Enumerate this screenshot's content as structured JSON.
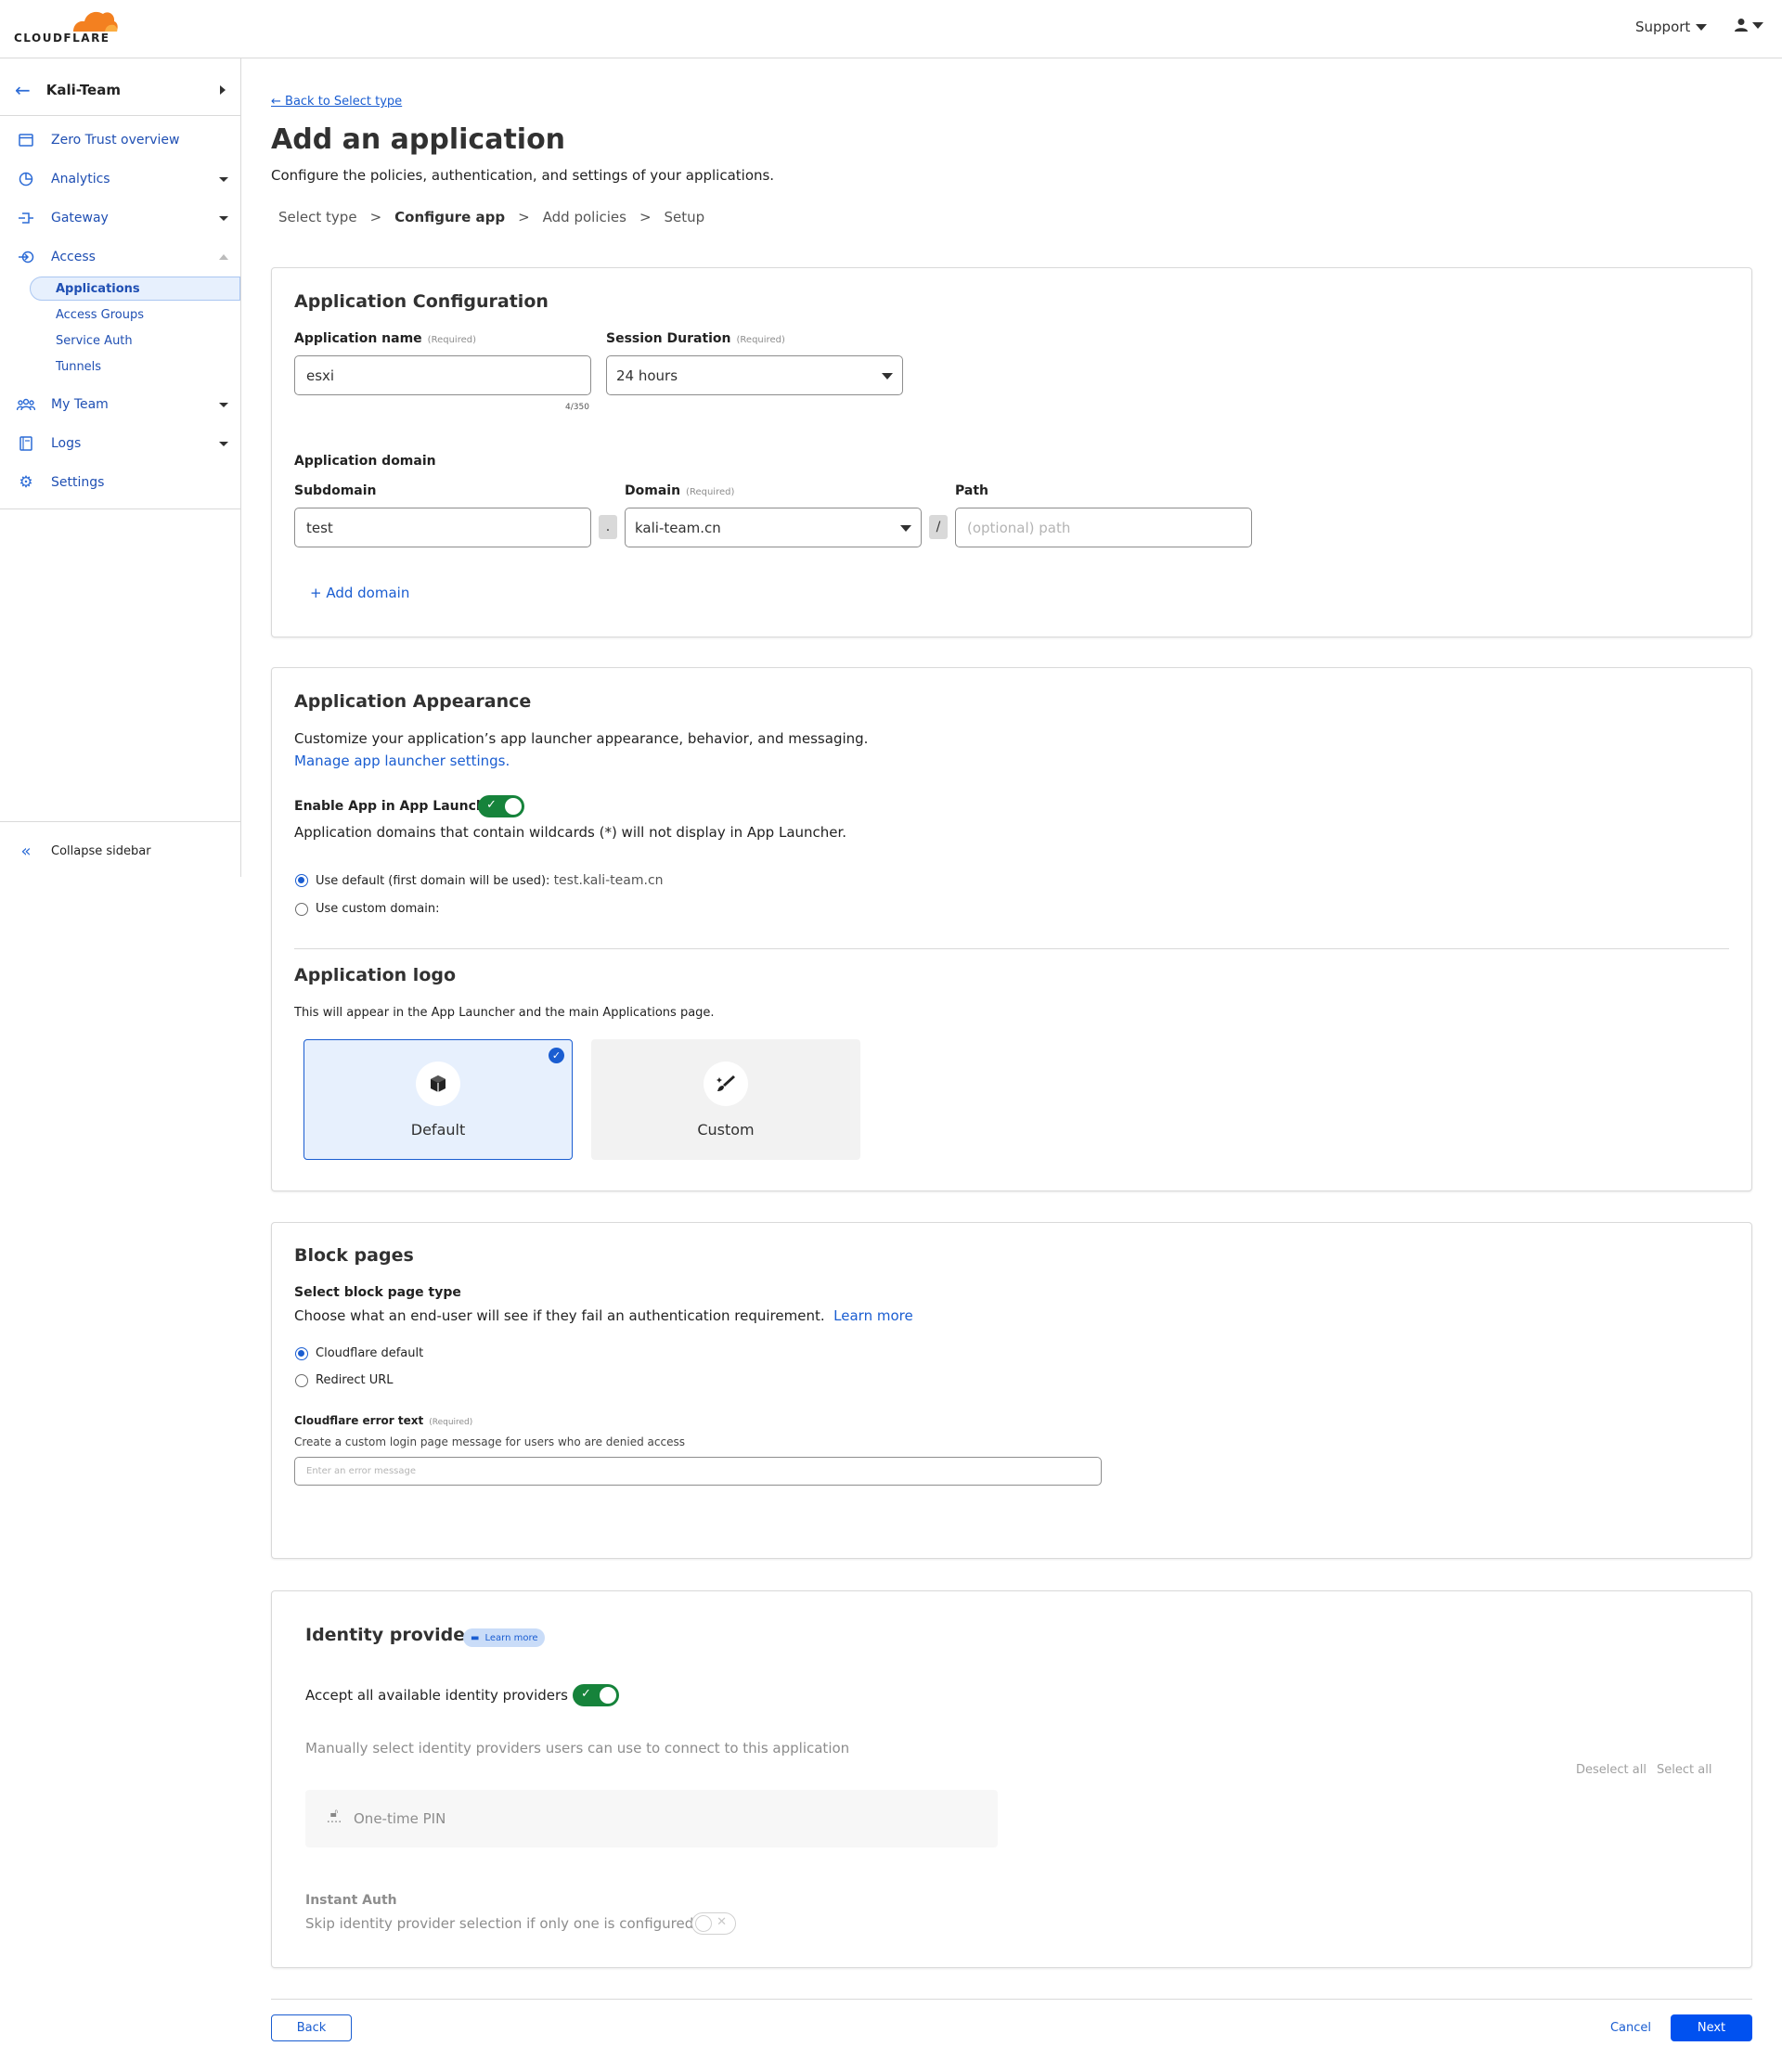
{
  "header": {
    "logo_text": "CLOUDFLARE",
    "support_label": "Support"
  },
  "sidebar": {
    "account_name": "Kali-Team",
    "items": [
      {
        "label": "Zero Trust overview",
        "icon": "window-icon"
      },
      {
        "label": "Analytics",
        "icon": "chart-icon"
      },
      {
        "label": "Gateway",
        "icon": "gateway-icon"
      },
      {
        "label": "Access",
        "icon": "access-icon"
      },
      {
        "label": "My Team",
        "icon": "team-icon"
      },
      {
        "label": "Logs",
        "icon": "logs-icon"
      },
      {
        "label": "Settings",
        "icon": "gear-icon"
      }
    ],
    "access_sub": [
      {
        "label": "Applications"
      },
      {
        "label": "Access Groups"
      },
      {
        "label": "Service Auth"
      },
      {
        "label": "Tunnels"
      }
    ],
    "collapse_label": "Collapse sidebar"
  },
  "page": {
    "back_link": "← Back to Select type",
    "title": "Add an application",
    "subtitle": "Configure the policies, authentication, and settings of your applications.",
    "steps": [
      "Select type",
      "Configure app",
      "Add policies",
      "Setup"
    ],
    "step_sep": ">"
  },
  "config": {
    "title": "Application Configuration",
    "required_tag": "(Required)",
    "app_name_label": "Application name",
    "app_name_value": "esxi",
    "app_name_counter": "4/350",
    "session_label": "Session Duration",
    "session_value": "24 hours",
    "domain_heading": "Application domain",
    "subdomain_label": "Subdomain",
    "subdomain_value": "test",
    "dot_sep": ".",
    "domain_label": "Domain",
    "domain_value": "kali-team.cn",
    "slash_sep": "/",
    "path_label": "Path",
    "path_placeholder": "(optional) path",
    "add_domain": "+ Add domain"
  },
  "appearance": {
    "title": "Application Appearance",
    "desc": "Customize your application’s app launcher appearance, behavior, and messaging.",
    "manage_link": "Manage app launcher settings.",
    "enable_label": "Enable App in App Launcher",
    "wildcard_note": "Application domains that contain wildcards (*) will not display in App Launcher.",
    "use_default_label": "Use default (first domain will be used):",
    "use_default_value": "test.kali-team.cn",
    "use_custom_label": "Use custom domain:",
    "logo_title": "Application logo",
    "logo_desc": "This will appear in the App Launcher and the main Applications page.",
    "logo_default": "Default",
    "logo_custom": "Custom"
  },
  "block": {
    "title": "Block pages",
    "select_label": "Select block page type",
    "desc": "Choose what an end-user will see if they fail an authentication requirement.",
    "learn_more": "Learn more",
    "opt_default": "Cloudflare default",
    "opt_redirect": "Redirect URL",
    "error_label": "Cloudflare error text",
    "error_desc": "Create a custom login page message for users who are denied access",
    "error_placeholder": "Enter an error message"
  },
  "idp": {
    "title": "Identity providers",
    "learn_more": "Learn more",
    "accept_label": "Accept all available identity providers",
    "manual_note": "Manually select identity providers users can use to connect to this application",
    "deselect_all": "Deselect all",
    "select_all": "Select all",
    "provider": "One-time PIN",
    "instant_title": "Instant Auth",
    "instant_desc": "Skip identity provider selection if only one is configured"
  },
  "footer": {
    "back": "Back",
    "cancel": "Cancel",
    "next": "Next"
  },
  "colors": {
    "accent": "#1a5dd1",
    "toggle_on": "#16833b",
    "cloud_orange": "#f38020"
  }
}
